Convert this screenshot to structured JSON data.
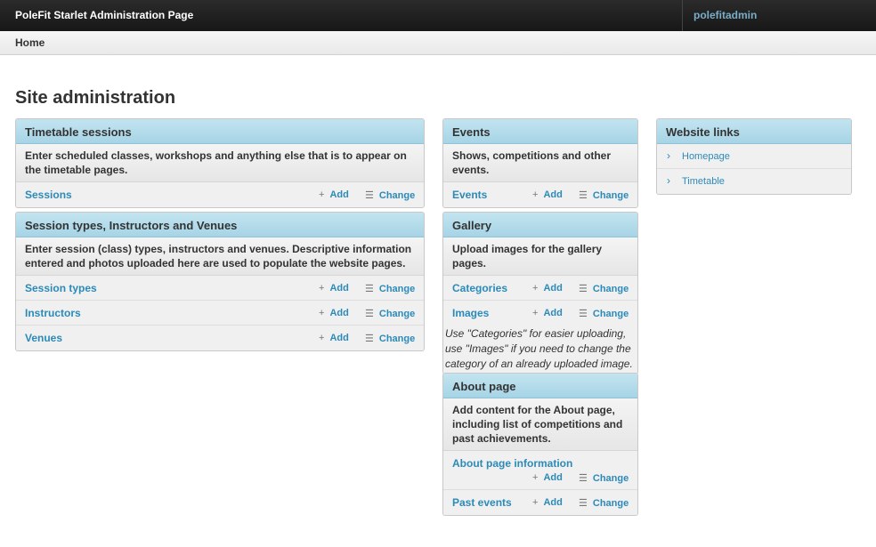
{
  "header": {
    "title": "PoleFit Starlet Administration Page",
    "user": "polefitadmin"
  },
  "breadcrumb": {
    "home": "Home"
  },
  "page_title": "Site administration",
  "actions": {
    "add": "Add",
    "change": "Change",
    "add_icon": "+",
    "change_icon": "☰"
  },
  "modules": {
    "timetable": {
      "title": "Timetable sessions",
      "description": "Enter scheduled classes, workshops and anything else that is to appear on the timetable pages.",
      "rows": [
        "Sessions"
      ]
    },
    "session_types": {
      "title": "Session types, Instructors and Venues",
      "description": "Enter session (class) types, instructors and venues. Descriptive information entered and photos uploaded here are used to populate the website pages.",
      "rows": [
        "Session types",
        "Instructors",
        "Venues"
      ]
    },
    "events": {
      "title": "Events",
      "description": "Shows, competitions and other events.",
      "rows": [
        "Events"
      ]
    },
    "gallery": {
      "title": "Gallery",
      "description": "Upload images for the gallery pages.",
      "rows": [
        "Categories",
        "Images"
      ],
      "note": "Use \"Categories\" for easier uploading, use \"Images\" if you need to change the category of an already uploaded image."
    },
    "about": {
      "title": "About page",
      "description": "Add content for the About page, including list of competitions and past achievements.",
      "rows": [
        "About page information",
        "Past events"
      ]
    },
    "website_links": {
      "title": "Website links",
      "chevron": "›",
      "links": [
        "Homepage",
        "Timetable"
      ]
    }
  }
}
